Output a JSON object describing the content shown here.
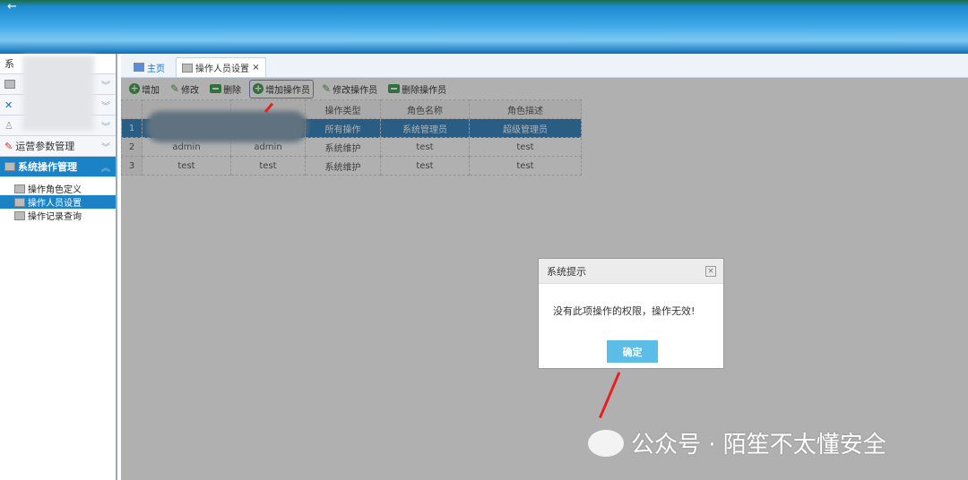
{
  "banner": {
    "back": "←"
  },
  "sidebar": {
    "top_label": "系",
    "groups": [
      {
        "label": "",
        "icon": "window-icon"
      },
      {
        "label": "",
        "icon": "tools-icon"
      },
      {
        "label": "",
        "icon": "user-icon"
      },
      {
        "label": "运营参数管理",
        "icon": "edit-icon"
      },
      {
        "label": "系统操作管理",
        "icon": "monitor-icon",
        "active": true
      }
    ],
    "items": [
      "操作角色定义",
      "操作人员设置",
      "操作记录查询"
    ]
  },
  "tabs": [
    {
      "label": "主页"
    },
    {
      "label": "操作人员设置",
      "close": "×"
    }
  ],
  "toolbar": [
    "增加",
    "修改",
    "删除",
    "增加操作员",
    "修改操作员",
    "删除操作员"
  ],
  "table": {
    "headers": [
      "",
      "",
      "操作类型",
      "角色名称",
      "角色描述"
    ],
    "rows": [
      [
        "1",
        "",
        "",
        "所有操作",
        "系统管理员",
        "超级管理员"
      ],
      [
        "2",
        "admin",
        "admin",
        "系统维护",
        "test",
        "test"
      ],
      [
        "3",
        "test",
        "test",
        "系统维护",
        "test",
        "test"
      ]
    ]
  },
  "dialog": {
    "title": "系统提示",
    "close": "×",
    "message": "没有此项操作的权限，操作无效!",
    "ok": "确定"
  },
  "watermark": "公众号 · 陌笙不太懂安全"
}
